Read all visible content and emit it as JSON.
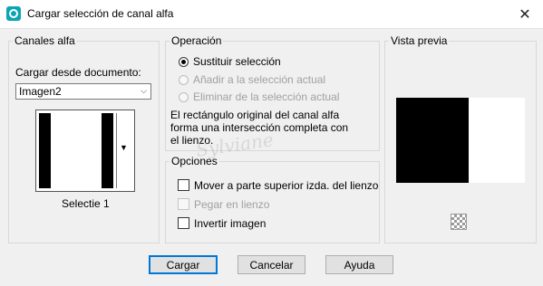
{
  "window": {
    "title": "Cargar selección de canal alfa"
  },
  "channels": {
    "legend": "Canales alfa",
    "source_label": "Cargar desde documento:",
    "document_value": "Imagen2",
    "channel_name": "Selectie 1"
  },
  "operation": {
    "legend": "Operación",
    "options": [
      {
        "label": "Sustituir selección",
        "checked": true,
        "enabled": true
      },
      {
        "label": "Añadir a la selección actual",
        "checked": false,
        "enabled": false
      },
      {
        "label": "Eliminar de la selección actual",
        "checked": false,
        "enabled": false
      }
    ],
    "description_lines": [
      "El rectángulo original del canal alfa",
      "forma una intersección completa con",
      "el lienzo."
    ]
  },
  "options": {
    "legend": "Opciones",
    "items": [
      {
        "label": "Mover a parte superior izda. del lienzo",
        "checked": false,
        "enabled": true
      },
      {
        "label": "Pegar en lienzo",
        "checked": false,
        "enabled": false
      },
      {
        "label": "Invertir imagen",
        "checked": false,
        "enabled": true
      }
    ]
  },
  "preview": {
    "legend": "Vista previa"
  },
  "buttons": {
    "load": "Cargar",
    "cancel": "Cancelar",
    "help": "Ayuda"
  },
  "watermark": "Sylviane",
  "icons": {
    "app": "alpha-channel-icon",
    "close": "close-icon",
    "arrow": "dropdown-arrow-icon",
    "zoom": "checker-zoom-icon"
  }
}
